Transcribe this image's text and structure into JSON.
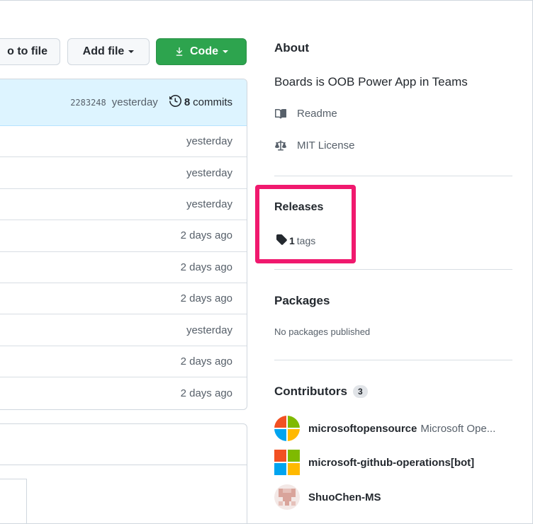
{
  "toolbar": {
    "goto_label": "o to file",
    "add_file_label": "Add file",
    "code_label": "Code"
  },
  "commit_bar": {
    "sha": "2283248",
    "when": "yesterday",
    "commit_count": "8",
    "commits_word": "commits"
  },
  "file_rows": [
    "yesterday",
    "yesterday",
    "yesterday",
    "2 days ago",
    "2 days ago",
    "2 days ago",
    "yesterday",
    "2 days ago",
    "2 days ago"
  ],
  "about": {
    "title": "About",
    "description": "Boards is OOB Power App in Teams",
    "readme_label": "Readme",
    "license_label": "MIT License"
  },
  "releases": {
    "title": "Releases",
    "tag_count": "1",
    "tags_word": "tags"
  },
  "packages": {
    "title": "Packages",
    "empty_text": "No packages published"
  },
  "contributors": {
    "title": "Contributors",
    "count": "3",
    "items": [
      {
        "login": "microsoftopensource",
        "name": "Microsoft Ope..."
      },
      {
        "login": "microsoft-github-operations[bot]",
        "name": ""
      },
      {
        "login": "ShuoChen-MS",
        "name": ""
      }
    ]
  },
  "colors": {
    "code_button": "#2da44e",
    "commit_bar_bg": "#ddf4ff",
    "highlight": "#f0196e"
  },
  "icons": {
    "readme": "book-icon",
    "license": "law-icon",
    "tag": "tag-icon",
    "history": "history-icon",
    "download": "download-icon"
  }
}
